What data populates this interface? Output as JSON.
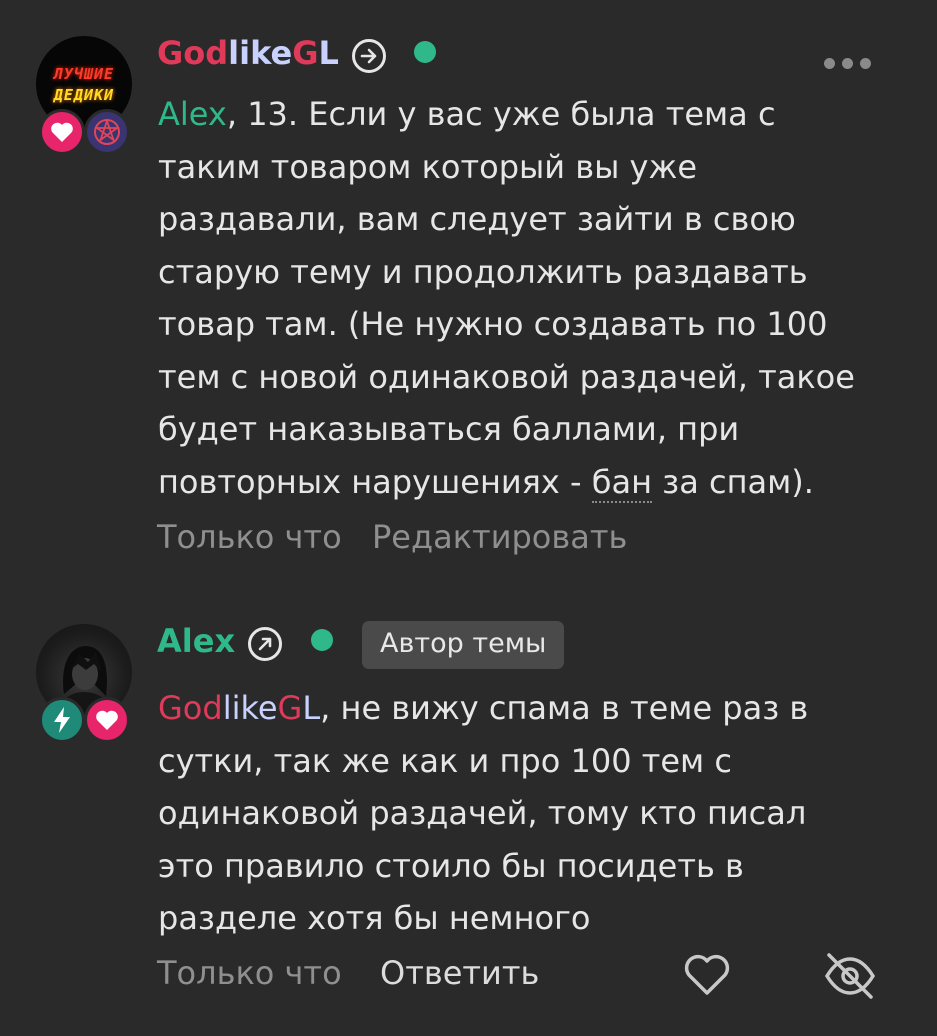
{
  "comments": [
    {
      "author": {
        "part1": "God",
        "part2": "like",
        "part3": "G",
        "part4": "L"
      },
      "avatar_text": {
        "line1": "ЛУЧШИЕ",
        "line2": "ДЕДИКИ"
      },
      "text": {
        "mention": "Alex",
        "line1": ", 13. Если у вас уже была тема с",
        "line2": "таким товаром который вы уже",
        "line3": "раздавали, вам следует зайти в свою",
        "line4": "старую тему и продолжить раздавать",
        "line5": "товар там. (Не нужно создавать по 100",
        "line6": "тем с новой одинаковой раздачей, такое",
        "line7": "будет наказываться баллами, при",
        "line8_a": "повторных нарушениях - ",
        "line8_link": "бан",
        "line8_b": " за спам)."
      },
      "time": "Только что",
      "action": "Редактировать"
    },
    {
      "author": {
        "name": "Alex"
      },
      "author_badge": "Автор темы",
      "text": {
        "mention": {
          "part1": "God",
          "part2": "like",
          "part3": "G",
          "part4": "L"
        },
        "line1": ", не вижу спама в теме раз в",
        "line2": "сутки, так же как и про 100 тем с",
        "line3": "одинаковой раздачей, тому кто писал",
        "line4": "это правило стоило бы посидеть в",
        "line5": "разделе хотя бы немного"
      },
      "time": "Только что",
      "action": "Ответить"
    }
  ],
  "colors": {
    "background": "#2a2a2a",
    "accent_green": "#2fb98a",
    "name_red": "#e03a5a",
    "name_light": "#c9d2ff",
    "heart_pink": "#e8246b",
    "badge_teal": "#1f8a78",
    "muted": "#8f8f8f"
  },
  "icons": [
    "arrow-right-circle-icon",
    "arrow-up-right-circle-icon",
    "heart-badge-icon",
    "pentagram-badge-icon",
    "lightning-badge-icon",
    "more-dots-icon",
    "heart-outline-icon",
    "eye-off-icon"
  ]
}
